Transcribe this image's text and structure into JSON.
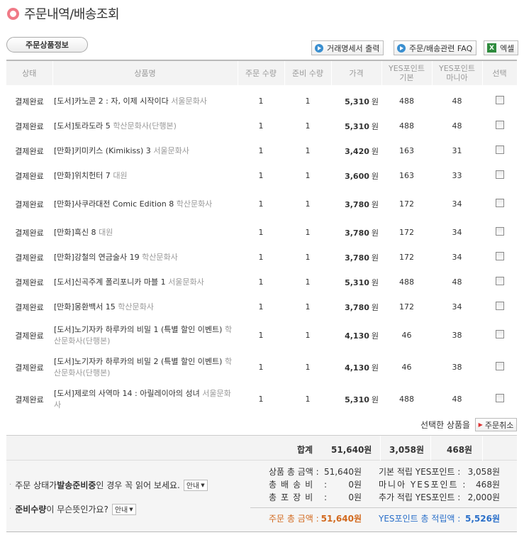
{
  "header": {
    "title": "주문내역/배송조회"
  },
  "section_tab": "주문상품정보",
  "toolbar": {
    "statement_label": "거래명세서 출력",
    "faq_label": "주문/배송관련 FAQ",
    "excel_icon_text": "X",
    "excel_label": "엑셀"
  },
  "table": {
    "headers": {
      "status": "상태",
      "product": "상품명",
      "order_qty": "주문 수량",
      "ready_qty": "준비 수량",
      "price": "가격",
      "yes_basic": [
        "YES포인트",
        "기본"
      ],
      "yes_mania": [
        "YES포인트",
        "마니아"
      ],
      "select": "선택"
    },
    "currency_unit": "원",
    "rows": [
      {
        "status": "결제완료",
        "product": "[도서]카노콘 2 : 자, 이제 시작이다",
        "publisher": "서울문화사",
        "order_qty": "1",
        "ready_qty": "1",
        "price": "5,310",
        "basic": "488",
        "mania": "48"
      },
      {
        "status": "결제완료",
        "product": "[도서]토라도라 5",
        "publisher": "학산문화사(단행본)",
        "order_qty": "1",
        "ready_qty": "1",
        "price": "5,310",
        "basic": "488",
        "mania": "48"
      },
      {
        "status": "결제완료",
        "product": "[만화]키미키스 (Kimikiss) 3",
        "publisher": "서울문화사",
        "order_qty": "1",
        "ready_qty": "1",
        "price": "3,420",
        "basic": "163",
        "mania": "31"
      },
      {
        "status": "결제완료",
        "product": "[만화]위치헌터 7",
        "publisher": "대원",
        "order_qty": "1",
        "ready_qty": "1",
        "price": "3,600",
        "basic": "163",
        "mania": "33"
      },
      {
        "status": "결제완료",
        "product": "[만화]사쿠라대전 Comic Edition 8",
        "publisher": "학산문화사",
        "order_qty": "1",
        "ready_qty": "1",
        "price": "3,780",
        "basic": "172",
        "mania": "34"
      },
      {
        "status": "결제완료",
        "product": "[만화]흑신 8",
        "publisher": "대원",
        "order_qty": "1",
        "ready_qty": "1",
        "price": "3,780",
        "basic": "172",
        "mania": "34"
      },
      {
        "status": "결제완료",
        "product": "[만화]강철의 연금술사 19",
        "publisher": "학산문화사",
        "order_qty": "1",
        "ready_qty": "1",
        "price": "3,780",
        "basic": "172",
        "mania": "34"
      },
      {
        "status": "결제완료",
        "product": "[도서]신곡주계 폴리포니카 마블 1",
        "publisher": "서울문화사",
        "order_qty": "1",
        "ready_qty": "1",
        "price": "5,310",
        "basic": "488",
        "mania": "48"
      },
      {
        "status": "결제완료",
        "product": "[만화]몽환백서 15",
        "publisher": "학산문화사",
        "order_qty": "1",
        "ready_qty": "1",
        "price": "3,780",
        "basic": "172",
        "mania": "34"
      },
      {
        "status": "결제완료",
        "product": "[도서]노기자카 하루카의 비밀 1 (특별 할인 이벤트)",
        "publisher": "학산문화사(단행본)",
        "order_qty": "1",
        "ready_qty": "1",
        "price": "4,130",
        "basic": "46",
        "mania": "38"
      },
      {
        "status": "결제완료",
        "product": "[도서]노기자카 하루카의 비밀 2 (특별 할인 이벤트)",
        "publisher": "학산문화사(단행본)",
        "order_qty": "1",
        "ready_qty": "1",
        "price": "4,130",
        "basic": "46",
        "mania": "38"
      },
      {
        "status": "결제완료",
        "product": "[도서]제로의 사역마 14 : 아릴레이아의 성녀",
        "publisher": "서울문화사",
        "order_qty": "1",
        "ready_qty": "1",
        "price": "5,310",
        "basic": "488",
        "mania": "48"
      }
    ]
  },
  "selection": {
    "label": "선택한 상품을",
    "cancel_label": "주문취소"
  },
  "totals_row": {
    "label": "합계",
    "price": "51,640원",
    "basic": "3,058원",
    "mania": "468원"
  },
  "notes": {
    "note1_pre": "주문 상태가 ",
    "note1_bold": "발송준비중",
    "note1_post": "인 경우 꼭 읽어 보세요.",
    "note2_bold": "준비수량",
    "note2_post": "이 무슨뜻인가요?",
    "info_label": "안내"
  },
  "amounts": {
    "product_total_label": "상품 총 금액 :",
    "product_total": "51,640원",
    "shipping_label": "총배송비 :",
    "shipping": "0원",
    "wrapping_label": "총포장비 :",
    "wrapping": "0원",
    "basic_points_label": "기본 적립 YES포인트 :",
    "basic_points": "3,058원",
    "mania_points_label": "마니아 YES포인트 :",
    "mania_points": "468원",
    "extra_points_label": "추가 적립 YES포인트 :",
    "extra_points": "2,000원",
    "order_total_label": "주문 총 금액 :",
    "order_total": "51,640원",
    "points_total_label": "YES포인트 총 적립액 :",
    "points_total": "5,526원"
  },
  "colors": {
    "status": "#d2691e",
    "accent_blue": "#2a6fc9",
    "title_bullet": "#f07a87"
  }
}
